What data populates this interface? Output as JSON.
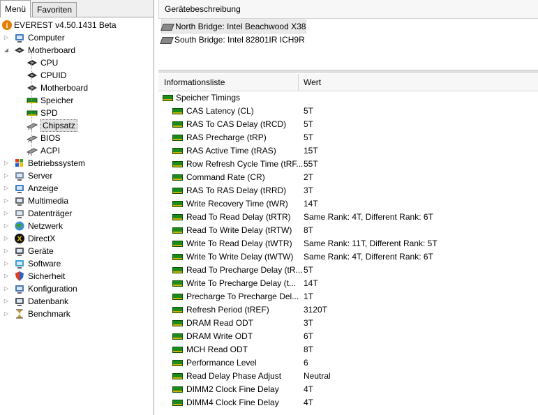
{
  "tabs": [
    {
      "label": "Menü",
      "active": true
    },
    {
      "label": "Favoriten",
      "active": false
    }
  ],
  "tree": {
    "root": {
      "label": "EVEREST v4.50.1431 Beta",
      "icon": "info-icon"
    },
    "items": [
      {
        "label": "Computer",
        "icon": "computer-icon",
        "expander": "collapsed"
      },
      {
        "label": "Motherboard",
        "icon": "motherboard-icon",
        "expander": "expanded",
        "children": [
          {
            "label": "CPU",
            "icon": "cpu-icon"
          },
          {
            "label": "CPUID",
            "icon": "cpuid-icon"
          },
          {
            "label": "Motherboard",
            "icon": "motherboard-icon"
          },
          {
            "label": "Speicher",
            "icon": "memory-icon"
          },
          {
            "label": "SPD",
            "icon": "spd-icon"
          },
          {
            "label": "Chipsatz",
            "icon": "chipset-icon",
            "selected": true
          },
          {
            "label": "BIOS",
            "icon": "bios-icon"
          },
          {
            "label": "ACPI",
            "icon": "acpi-icon"
          }
        ]
      },
      {
        "label": "Betriebssystem",
        "icon": "windows-icon",
        "expander": "collapsed"
      },
      {
        "label": "Server",
        "icon": "server-icon",
        "expander": "collapsed"
      },
      {
        "label": "Anzeige",
        "icon": "display-icon",
        "expander": "collapsed"
      },
      {
        "label": "Multimedia",
        "icon": "multimedia-icon",
        "expander": "collapsed"
      },
      {
        "label": "Datenträger",
        "icon": "storage-icon",
        "expander": "collapsed"
      },
      {
        "label": "Netzwerk",
        "icon": "network-icon",
        "expander": "collapsed"
      },
      {
        "label": "DirectX",
        "icon": "directx-icon",
        "expander": "collapsed"
      },
      {
        "label": "Geräte",
        "icon": "devices-icon",
        "expander": "collapsed"
      },
      {
        "label": "Software",
        "icon": "software-icon",
        "expander": "collapsed"
      },
      {
        "label": "Sicherheit",
        "icon": "security-icon",
        "expander": "collapsed"
      },
      {
        "label": "Konfiguration",
        "icon": "configuration-icon",
        "expander": "collapsed"
      },
      {
        "label": "Datenbank",
        "icon": "database-icon",
        "expander": "collapsed"
      },
      {
        "label": "Benchmark",
        "icon": "benchmark-icon",
        "expander": "collapsed"
      }
    ]
  },
  "device_panel": {
    "header": "Gerätebeschreibung",
    "devices": [
      {
        "label": "North Bridge: Intel Beachwood X38",
        "icon": "chip-icon",
        "selected": true
      },
      {
        "label": "South Bridge: Intel 82801IR ICH9R",
        "icon": "chip-icon",
        "selected": false
      }
    ]
  },
  "info_list": {
    "columns": [
      "Informationsliste",
      "Wert"
    ],
    "group": {
      "label": "Speicher Timings",
      "icon": "memory-module-icon"
    },
    "rows": [
      {
        "name": "CAS Latency (CL)",
        "value": "5T"
      },
      {
        "name": "RAS To CAS Delay (tRCD)",
        "value": "5T"
      },
      {
        "name": "RAS Precharge (tRP)",
        "value": "5T"
      },
      {
        "name": "RAS Active Time (tRAS)",
        "value": "15T"
      },
      {
        "name": "Row Refresh Cycle Time (tRF...",
        "value": "55T"
      },
      {
        "name": "Command Rate (CR)",
        "value": "2T"
      },
      {
        "name": "RAS To RAS Delay (tRRD)",
        "value": "3T"
      },
      {
        "name": "Write Recovery Time (tWR)",
        "value": "14T"
      },
      {
        "name": "Read To Read Delay (tRTR)",
        "value": "Same Rank: 4T, Different Rank: 6T"
      },
      {
        "name": "Read To Write Delay (tRTW)",
        "value": "8T"
      },
      {
        "name": "Write To Read Delay (tWTR)",
        "value": "Same Rank: 11T, Different Rank: 5T"
      },
      {
        "name": "Write To Write Delay (tWTW)",
        "value": "Same Rank: 4T, Different Rank: 6T"
      },
      {
        "name": "Read To Precharge Delay (tR...",
        "value": "5T"
      },
      {
        "name": "Write To Precharge Delay (t...",
        "value": "14T"
      },
      {
        "name": "Precharge To Precharge Del...",
        "value": "1T"
      },
      {
        "name": "Refresh Period (tREF)",
        "value": "3120T"
      },
      {
        "name": "DRAM Read ODT",
        "value": "3T"
      },
      {
        "name": "DRAM Write ODT",
        "value": "6T"
      },
      {
        "name": "MCH Read ODT",
        "value": "8T"
      },
      {
        "name": "Performance Level",
        "value": "6"
      },
      {
        "name": "Read Delay Phase Adjust",
        "value": "Neutral"
      },
      {
        "name": "DIMM2 Clock Fine Delay",
        "value": "4T"
      },
      {
        "name": "DIMM4 Clock Fine Delay",
        "value": "4T"
      }
    ]
  }
}
